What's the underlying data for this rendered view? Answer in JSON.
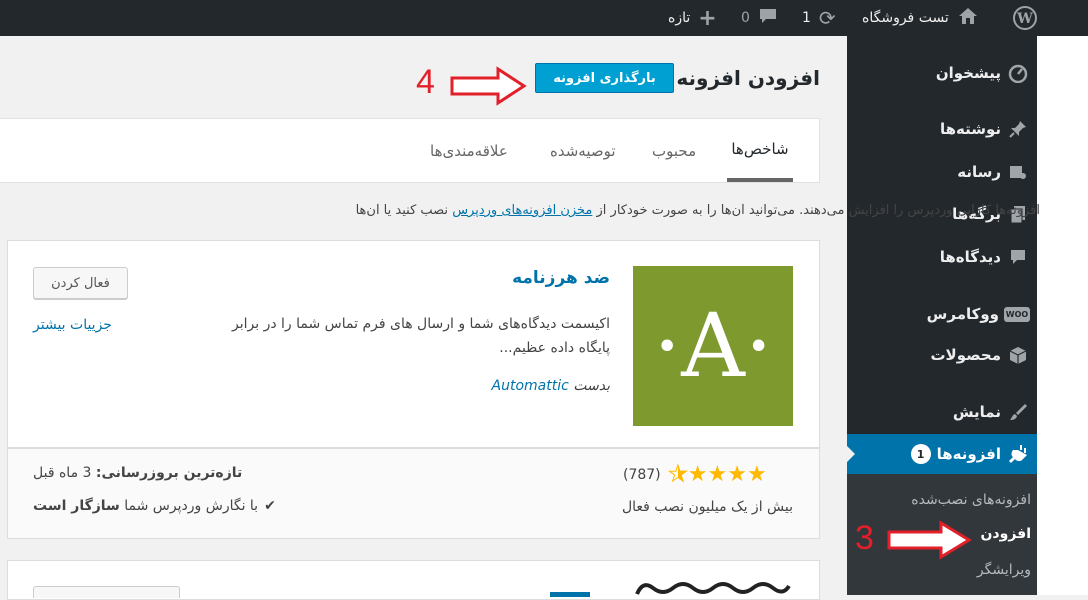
{
  "adminbar": {
    "site_name": "تست فروشگاه",
    "updates_count": "1",
    "comments_count": "0",
    "new_label": "تازه"
  },
  "sidebar": {
    "items": [
      {
        "label": "پیشخوان",
        "icon": "dashboard-icon"
      },
      {
        "label": "نوشته‌ها",
        "icon": "pin-icon"
      },
      {
        "label": "رسانه",
        "icon": "media-icon"
      },
      {
        "label": "برگه‌ها",
        "icon": "pages-icon"
      },
      {
        "label": "دیدگاه‌ها",
        "icon": "comment-icon"
      },
      {
        "label": "ووکامرس",
        "icon": "woo-icon",
        "icon_text": "WOO"
      },
      {
        "label": "محصولات",
        "icon": "box-icon"
      },
      {
        "label": "نمایش",
        "icon": "brush-icon"
      },
      {
        "label": "افزونه‌ها",
        "icon": "plugin-icon",
        "badge": "1"
      }
    ],
    "submenu": [
      {
        "label": "افزونه‌های نصب‌شده"
      },
      {
        "label": "افزودن"
      },
      {
        "label": "ویرایشگر"
      }
    ]
  },
  "page": {
    "title": "افزودن افزونه",
    "upload_button": "بارگذاری افزونه"
  },
  "annotations": {
    "step4": "4",
    "step3": "3",
    "color": "#e2202a"
  },
  "tabs": [
    {
      "label": "شاخص‌ها",
      "active": true
    },
    {
      "label": "محبوب"
    },
    {
      "label": "توصیه‌شده"
    },
    {
      "label": "علاقه‌مندی‌ها"
    }
  ],
  "intro": {
    "part1": "افزونه‌ها کارایی وردپرس را افزایش می‌دهند. می‌توانید آن‌ها را به صورت خودکار از ",
    "link": "مخزن افزونه‌های وردپرس",
    "part2": " نصب کنید یا آن‌ها"
  },
  "plugin": {
    "name": "ضد هرزنامه",
    "icon_letter": "·A·",
    "description": "اکیسمت دیدگاه‌های شما و ارسال های فرم تماس شما را در برابر پایگاه داده عظیم...",
    "author_prefix": "بدست ",
    "author": "Automattic",
    "activate": "فعال کردن",
    "more_details": "جزییات بیشتر",
    "rating": 4.5,
    "rating_count": "(787)",
    "installs": "بیش از یک میلیون نصب فعال",
    "last_updated_label": "تازه‌ترین بروزرسانی:",
    "last_updated_value": "3 ماه قبل",
    "compat_prefix": "با نگارش وردپرس شما",
    "compat_value": "سازگار است",
    "compat_check": "✔"
  },
  "colors": {
    "adminbar": "#23282d",
    "accent": "#0073aa",
    "button": "#00a0d2",
    "plugin_icon_bg": "#7e9a2f",
    "star": "#ffb900"
  }
}
